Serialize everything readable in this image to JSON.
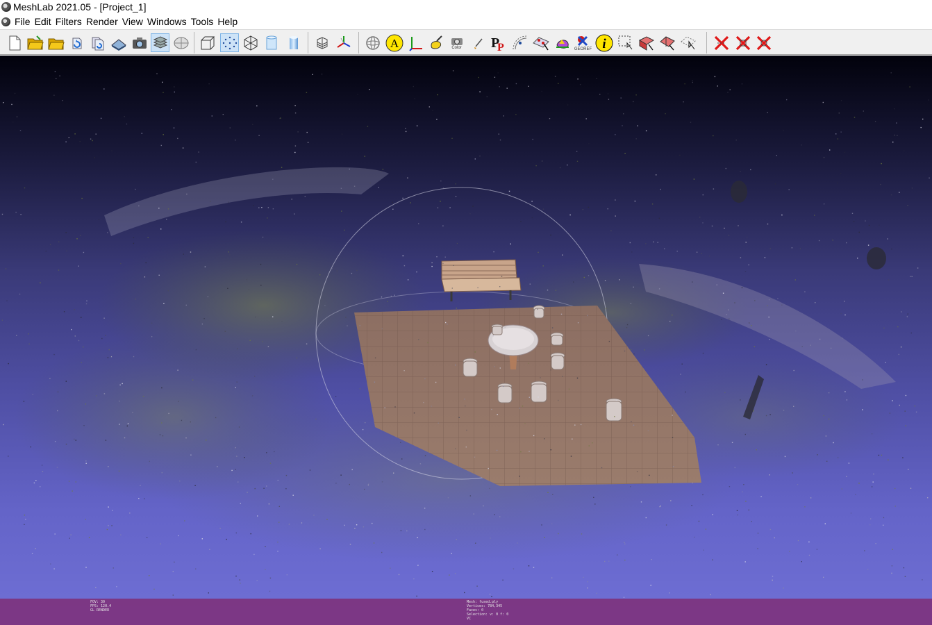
{
  "window": {
    "title": "MeshLab 2021.05 - [Project_1]"
  },
  "menu": {
    "items": [
      "File",
      "Edit",
      "Filters",
      "Render",
      "View",
      "Windows",
      "Tools",
      "Help"
    ]
  },
  "toolbar": {
    "buttons": [
      "new-project-icon",
      "open-project-icon",
      "open-folder-icon",
      "reload-icon",
      "reload-all-icon",
      "save-snapshot-icon",
      "screenshot-icon",
      "layers-icon",
      "raster-icon",
      "bounding-box-icon",
      "points-icon",
      "wireframe-icon",
      "flat-shading-icon",
      "smooth-shading-icon",
      "lighting-icon",
      "axis-icon",
      "trackball-icon",
      "annotation-a-icon",
      "align-axes-icon",
      "paint-icon",
      "camera-icon",
      "brush-icon",
      "pp-icon",
      "measure-icon",
      "pick-points-icon",
      "georef-icon",
      "info-icon",
      "select-vertices-icon",
      "select-faces-icon",
      "select-connected-icon",
      "select-vertex-icon",
      "delete-vertices-icon",
      "delete-faces-icon",
      "delete-selection-icon"
    ],
    "snapshot_caption": "Color",
    "georef_label": "GEOREF",
    "annotation_letter": "A",
    "info_letter": "i",
    "pp_label": "P"
  },
  "viewport": {
    "info_left": [
      "FOV: 30",
      "FPS:  120.4",
      "GL RENDER"
    ],
    "info_right": [
      "Mesh: fused.ply",
      "Vertices: 784,345",
      "Faces: 0",
      "Selection: v: 0 f: 0",
      "VC"
    ],
    "colors": {
      "info_bar": "#80286e",
      "sky_top": "#02020c",
      "sky_bottom": "#7070d6"
    }
  }
}
